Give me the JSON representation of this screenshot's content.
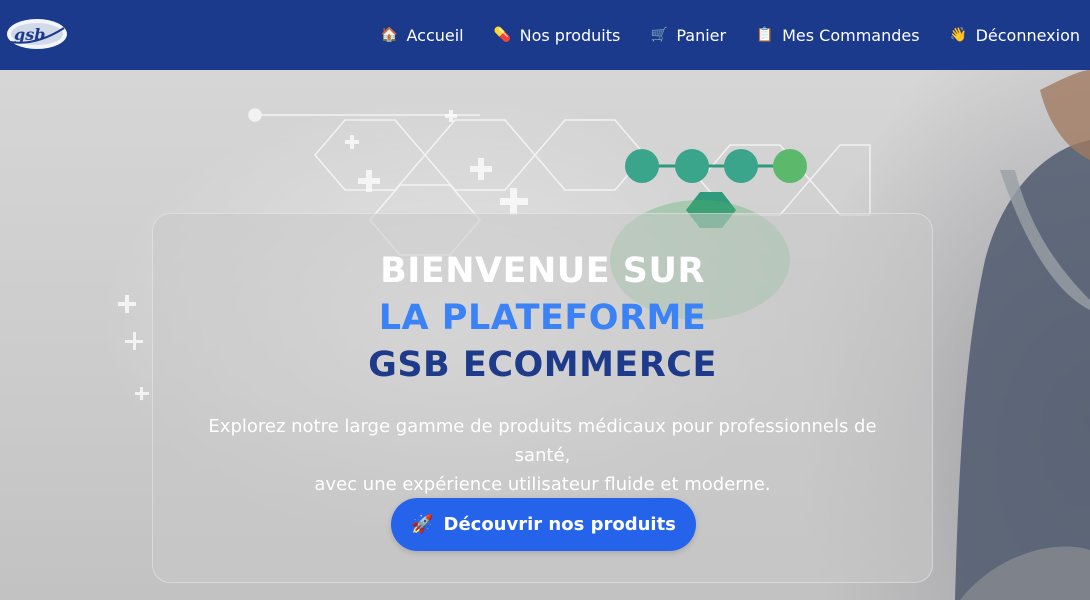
{
  "brand": {
    "logo_text": "gsb"
  },
  "nav": {
    "items": [
      {
        "icon": "home-icon",
        "glyph": "🏠",
        "label": "Accueil"
      },
      {
        "icon": "pill-icon",
        "glyph": "💊",
        "label": "Nos produits"
      },
      {
        "icon": "cart-icon",
        "glyph": "🛒",
        "label": "Panier"
      },
      {
        "icon": "clipboard-icon",
        "glyph": "📋",
        "label": "Mes Commandes"
      },
      {
        "icon": "wave-icon",
        "glyph": "👋",
        "label": "Déconnexion"
      }
    ]
  },
  "hero": {
    "title_line1": "BIENVENUE SUR",
    "title_line2": "LA PLATEFORME",
    "title_line3": "GSB ECOMMERCE",
    "subtitle_line1": "Explorez notre large gamme de produits médicaux pour professionnels de santé,",
    "subtitle_line2": "avec une expérience utilisateur fluide et moderne.",
    "cta_icon": "rocket-icon",
    "cta_glyph": "🚀",
    "cta_label": "Découvrir nos produits"
  },
  "colors": {
    "navbar": "#1b3a8c",
    "title_white": "#ffffff",
    "title_blue": "#3b82f6",
    "title_navy": "#1e3a8a",
    "cta": "#2563eb"
  }
}
